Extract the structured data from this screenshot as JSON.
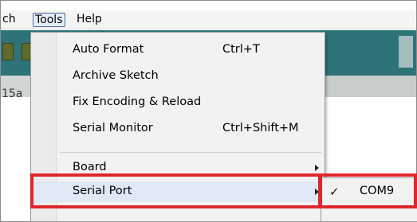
{
  "menubar": {
    "sketch_partial": "ch",
    "tools": "Tools",
    "help": "Help"
  },
  "editor": {
    "text_partial": "15a"
  },
  "tools_menu": {
    "items": [
      {
        "label": "Auto Format",
        "shortcut": "Ctrl+T"
      },
      {
        "label": "Archive Sketch",
        "shortcut": ""
      },
      {
        "label": "Fix Encoding & Reload",
        "shortcut": ""
      },
      {
        "label": "Serial Monitor",
        "shortcut": "Ctrl+Shift+M"
      },
      {
        "label": "Board",
        "shortcut": ""
      },
      {
        "label": "Serial Port",
        "shortcut": ""
      }
    ]
  },
  "serial_port_submenu": {
    "items": [
      {
        "label": "COM9",
        "checked": true,
        "icon": "check-icon"
      }
    ]
  },
  "colors": {
    "highlight_box": "#e0262d",
    "toolbar": "#2e7378"
  }
}
